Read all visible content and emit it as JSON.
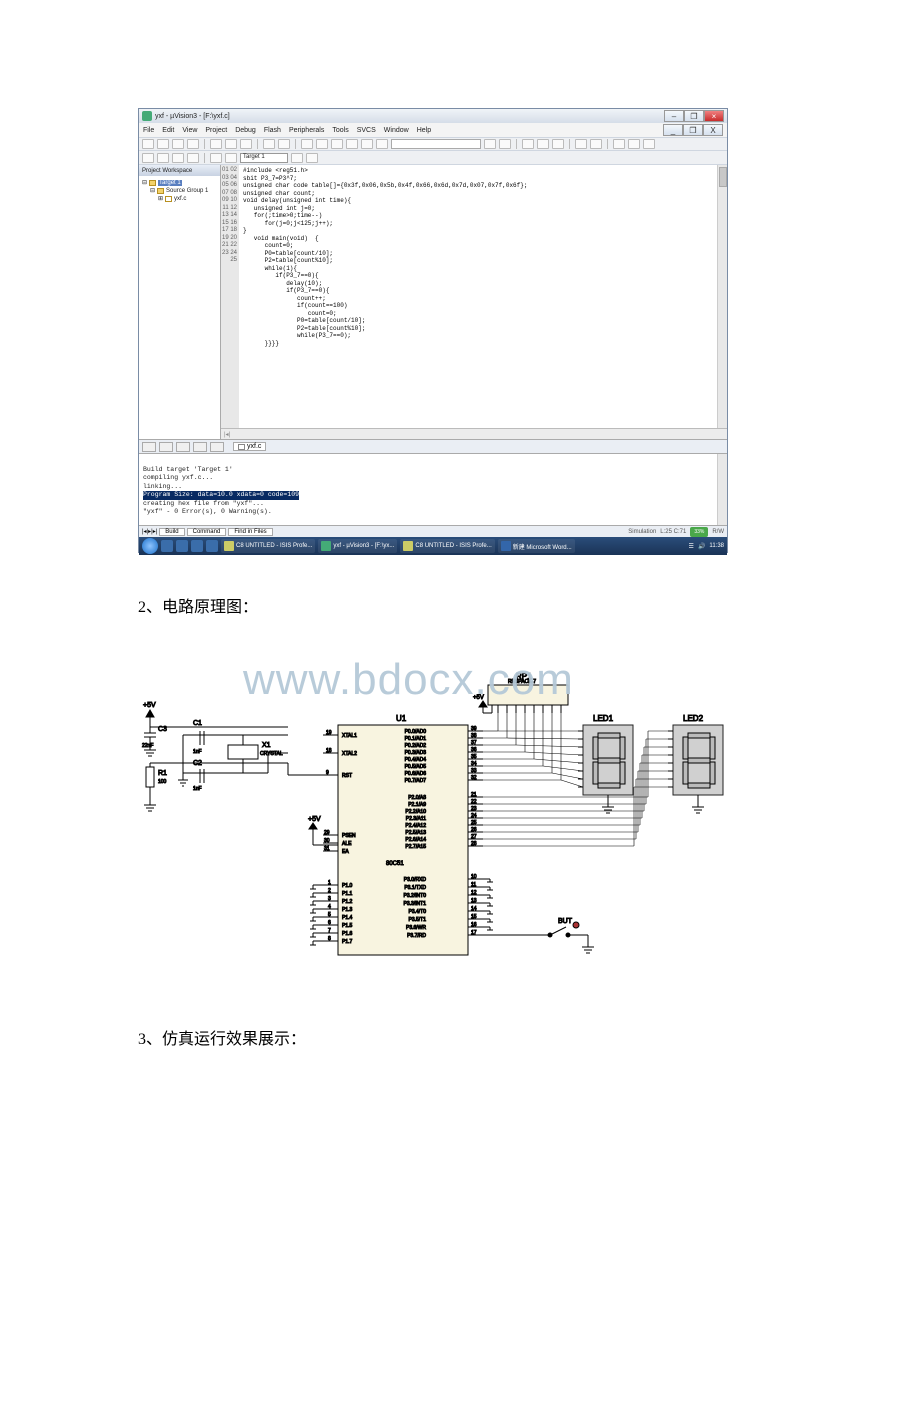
{
  "ide": {
    "title": "yxf - µVision3 - [F:\\yxf.c]",
    "window_buttons": {
      "min": "–",
      "max": "❐",
      "close": "×"
    },
    "inner_window_buttons": {
      "min": "_",
      "max": "❐",
      "close": "X"
    },
    "menu": [
      "File",
      "Edit",
      "View",
      "Project",
      "Debug",
      "Flash",
      "Peripherals",
      "Tools",
      "SVCS",
      "Window",
      "Help"
    ],
    "target_label": "Target 1",
    "workspace_title": "Project Workspace",
    "tree": {
      "root": "Target 1",
      "group": "Source Group 1",
      "file": "yxf.c"
    },
    "gutter": [
      "01",
      "02",
      "03",
      "04",
      "05",
      "06",
      "07",
      "08",
      "09",
      "10",
      "11",
      "12",
      "13",
      "14",
      "15",
      "16",
      "17",
      "18",
      "19",
      "20",
      "21",
      "22",
      "23",
      "24",
      "25"
    ],
    "code_lines": [
      "#include <reg51.h>",
      "sbit P3_7=P3^7;",
      "unsigned char code table[]={0x3f,0x06,0x5b,0x4f,0x66,0x6d,0x7d,0x07,0x7f,0x6f};",
      "unsigned char count;",
      "void delay(unsigned int time){",
      "   unsigned int j=0;",
      "   for(;time>0;time--)",
      "      for(j=0;j<125;j++);",
      "}",
      "   void main(void)  {",
      "      count=0;",
      "      P0=table[count/10];",
      "      P2=table[count%10];",
      "      while(1){",
      "         if(P3_7==0){",
      "            delay(10);",
      "            if(P3_7==0){",
      "               count++;",
      "               if(count==100)",
      "                  count=0;",
      "               P0=table[count/10];",
      "               P2=table[count%10];",
      "               while(P3_7==0);",
      "      }}}}",
      ""
    ],
    "editor_tab_file": "yxf.c",
    "output_lines": [
      "Build target 'Target 1'",
      "compiling yxf.c...",
      "linking...",
      "Program Size: data=10.0 xdata=0 code=109",
      "creating hex file from \"yxf\"...",
      "\"yxf\" - 0 Error(s), 0 Warning(s)."
    ],
    "build_tabs": [
      "Build",
      "Command",
      "Find in Files"
    ],
    "status_simulation": "Simulation",
    "status_time": "L:25 C:71",
    "status_cpu": "33%",
    "status_rw": "R/W",
    "taskbar_items": [
      "C8 UNTITLED - ISIS Profe...",
      "yxf - µVision3 - [F:\\yx...",
      "C8 UNTITLED - ISIS Profe...",
      "新建 Microsoft Word..."
    ],
    "taskbar_time": "11:38"
  },
  "headings": {
    "h2": "2、电路原理图：",
    "h3": "3、仿真运行效果展示："
  },
  "watermark": "www.bdocx.com",
  "circuit": {
    "rp1_name": "RP1",
    "rp1_type": "RESPACK-7",
    "u1_name": "U1",
    "u1_type": "80C51",
    "led1": "LED1",
    "led2": "LED2",
    "x1_name": "X1",
    "x1_type": "CRYSTAL",
    "c1_name": "C1",
    "c1_val": "1nF",
    "c2_name": "C2",
    "c2_val": "1nF",
    "c3_name": "C3",
    "c3_val": "22nF",
    "r1_name": "R1",
    "r1_val": "100",
    "but_name": "BUT",
    "vplus": "+5V",
    "u1_pins_left_upper": [
      {
        "n": "19",
        "lbl": "XTAL1"
      },
      {
        "n": "18",
        "lbl": "XTAL2"
      },
      {
        "n": "9",
        "lbl": "RST"
      }
    ],
    "u1_pins_left_lower": [
      {
        "n": "29",
        "lbl": "PSEN"
      },
      {
        "n": "30",
        "lbl": "ALE"
      },
      {
        "n": "31",
        "lbl": "EA"
      }
    ],
    "u1_pins_p1": [
      {
        "n": "1",
        "lbl": "P1.0"
      },
      {
        "n": "2",
        "lbl": "P1.1"
      },
      {
        "n": "3",
        "lbl": "P1.2"
      },
      {
        "n": "4",
        "lbl": "P1.3"
      },
      {
        "n": "5",
        "lbl": "P1.4"
      },
      {
        "n": "6",
        "lbl": "P1.5"
      },
      {
        "n": "7",
        "lbl": "P1.6"
      },
      {
        "n": "8",
        "lbl": "P1.7"
      }
    ],
    "u1_pins_p0": [
      {
        "n": "39",
        "lbl": "P0.0/AD0"
      },
      {
        "n": "38",
        "lbl": "P0.1/AD1"
      },
      {
        "n": "37",
        "lbl": "P0.2/AD2"
      },
      {
        "n": "36",
        "lbl": "P0.3/AD3"
      },
      {
        "n": "35",
        "lbl": "P0.4/AD4"
      },
      {
        "n": "34",
        "lbl": "P0.5/AD5"
      },
      {
        "n": "33",
        "lbl": "P0.6/AD6"
      },
      {
        "n": "32",
        "lbl": "P0.7/AD7"
      }
    ],
    "u1_pins_p2": [
      {
        "n": "21",
        "lbl": "P2.0/A8"
      },
      {
        "n": "22",
        "lbl": "P2.1/A9"
      },
      {
        "n": "23",
        "lbl": "P2.2/A10"
      },
      {
        "n": "24",
        "lbl": "P2.3/A11"
      },
      {
        "n": "25",
        "lbl": "P2.4/A12"
      },
      {
        "n": "26",
        "lbl": "P2.5/A13"
      },
      {
        "n": "27",
        "lbl": "P2.6/A14"
      },
      {
        "n": "28",
        "lbl": "P2.7/A15"
      }
    ],
    "u1_pins_p3": [
      {
        "n": "10",
        "lbl": "P3.0/RXD"
      },
      {
        "n": "11",
        "lbl": "P3.1/TXD"
      },
      {
        "n": "12",
        "lbl": "P3.2/INT0"
      },
      {
        "n": "13",
        "lbl": "P3.3/INT1"
      },
      {
        "n": "14",
        "lbl": "P3.4/T0"
      },
      {
        "n": "15",
        "lbl": "P3.5/T1"
      },
      {
        "n": "16",
        "lbl": "P3.6/WR"
      },
      {
        "n": "17",
        "lbl": "P3.7/RD"
      }
    ]
  }
}
